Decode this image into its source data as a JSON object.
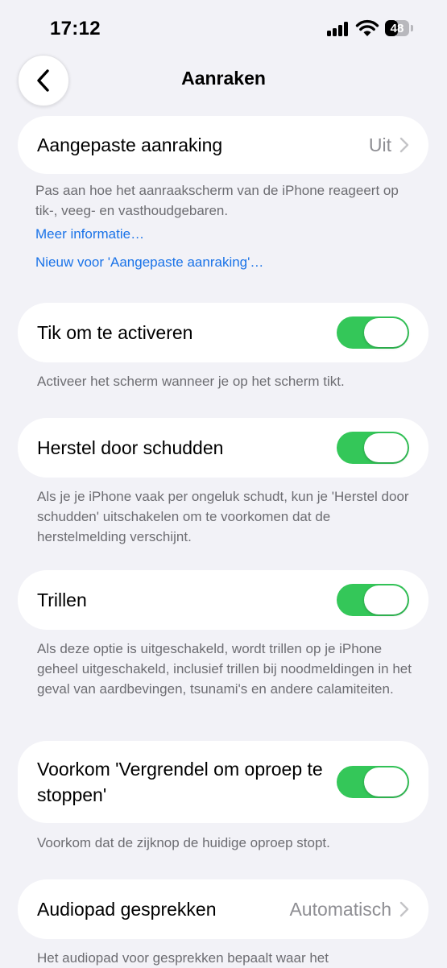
{
  "status_bar": {
    "time": "17:12",
    "battery": "48",
    "battery_level_percent": 48
  },
  "nav": {
    "title": "Aanraken",
    "back_icon": "chevron-left-icon"
  },
  "sections": {
    "custom_touch": {
      "label": "Aangepaste aanraking",
      "value": "Uit",
      "footer": "Pas aan hoe het aanraakscherm van de iPhone reageert op tik-, veeg- en vasthoudgebaren.",
      "link_more": "Meer informatie…",
      "link_new": "Nieuw voor 'Aangepaste aanraking'…"
    },
    "tap_to_wake": {
      "label": "Tik om te activeren",
      "on": true,
      "footer": "Activeer het scherm wanneer je op het scherm tikt."
    },
    "shake_to_undo": {
      "label": "Herstel door schudden",
      "on": true,
      "footer": "Als je je iPhone vaak per ongeluk schudt, kun je 'Herstel door schudden' uitschakelen om te voorkomen dat de herstelmelding verschijnt."
    },
    "vibration": {
      "label": "Trillen",
      "on": true,
      "footer": "Als deze optie is uitgeschakeld, wordt trillen op je iPhone geheel uitgeschakeld, inclusief trillen bij noodmeldingen in het geval van aardbevingen, tsunami's en andere calamiteiten."
    },
    "prevent_lock_end_call": {
      "label": "Voorkom 'Vergrendel om oproep te stoppen'",
      "on": true,
      "footer": "Voorkom dat de zijknop de huidige oproep stopt."
    },
    "call_audio_routing": {
      "label": "Audiopad gesprekken",
      "value": "Automatisch",
      "footer": "Het audiopad voor gesprekken bepaalt waar het"
    }
  }
}
